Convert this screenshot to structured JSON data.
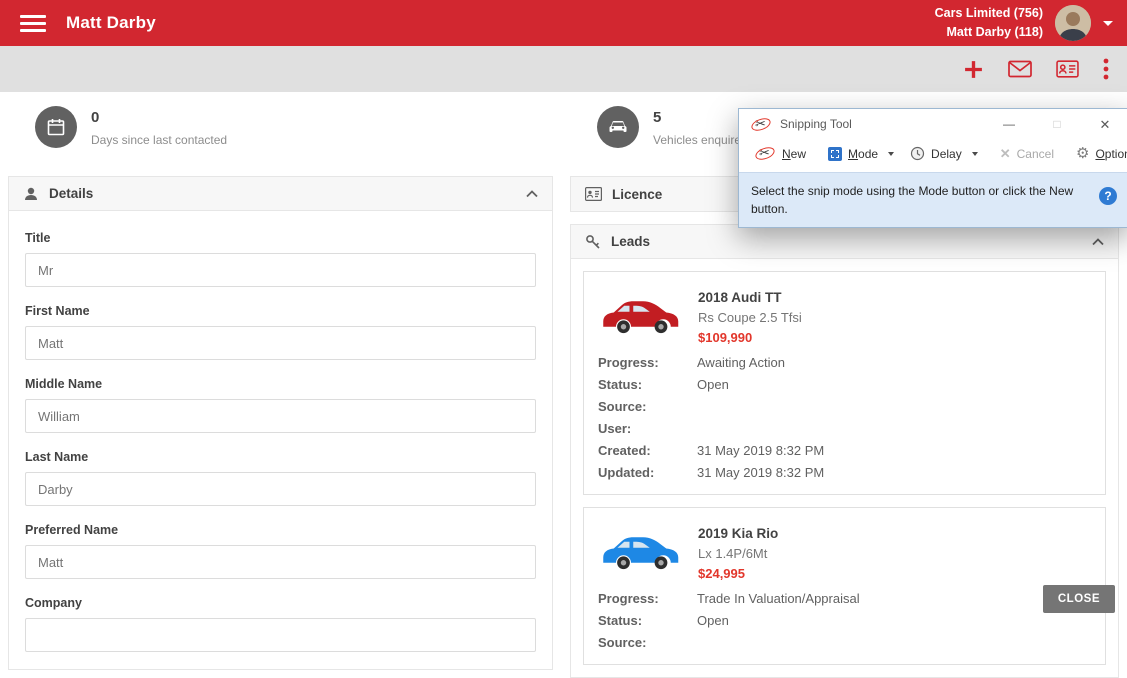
{
  "colors": {
    "brand_red": "#d22730",
    "price_red": "#e2362b",
    "icon_gray": "#616161",
    "info_bar_blue": "#dce9f8"
  },
  "header": {
    "title": "Matt Darby",
    "account_line1": "Cars Limited (756)",
    "account_line2": "Matt Darby (118)"
  },
  "action_toolbar": {
    "icons": [
      "add-icon",
      "mail-icon",
      "contact-card-icon",
      "more-menu-icon"
    ]
  },
  "stats": [
    {
      "value": "0",
      "label": "Days since last contacted",
      "icon": "calendar-icon"
    },
    {
      "value": "5",
      "label": "Vehicles enquired",
      "icon": "car-icon"
    }
  ],
  "details_panel": {
    "title": "Details",
    "fields": [
      {
        "label": "Title",
        "value": "Mr"
      },
      {
        "label": "First Name",
        "value": "Matt"
      },
      {
        "label": "Middle Name",
        "value": "William"
      },
      {
        "label": "Last Name",
        "value": "Darby"
      },
      {
        "label": "Preferred Name",
        "value": "Matt"
      },
      {
        "label": "Company",
        "value": ""
      }
    ]
  },
  "licence_panel": {
    "title": "Licence"
  },
  "leads_panel": {
    "title": "Leads",
    "leads": [
      {
        "name": "2018 Audi TT",
        "variant": "Rs Coupe 2.5 Tfsi",
        "price": "$109,990",
        "car_color": "#c21d22",
        "details": [
          {
            "label": "Progress:",
            "value": "Awaiting Action"
          },
          {
            "label": "Status:",
            "value": "Open"
          },
          {
            "label": "Source:",
            "value": ""
          },
          {
            "label": "User:",
            "value": ""
          },
          {
            "label": "Created:",
            "value": "31 May 2019 8:32 PM"
          },
          {
            "label": "Updated:",
            "value": "31 May 2019 8:32 PM"
          }
        ]
      },
      {
        "name": "2019 Kia Rio",
        "variant": "Lx 1.4P/6Mt",
        "price": "$24,995",
        "car_color": "#1e88e5",
        "details": [
          {
            "label": "Progress:",
            "value": "Trade In Valuation/Appraisal"
          },
          {
            "label": "Status:",
            "value": "Open"
          },
          {
            "label": "Source:",
            "value": ""
          }
        ]
      }
    ]
  },
  "close_button_label": "CLOSE",
  "snipping_tool": {
    "window_title": "Snipping Tool",
    "new_label": "New",
    "mode_label": "Mode",
    "delay_label": "Delay",
    "cancel_label": "Cancel",
    "options_label": "Options",
    "info_text": "Select the snip mode using the Mode button or click the New button."
  }
}
